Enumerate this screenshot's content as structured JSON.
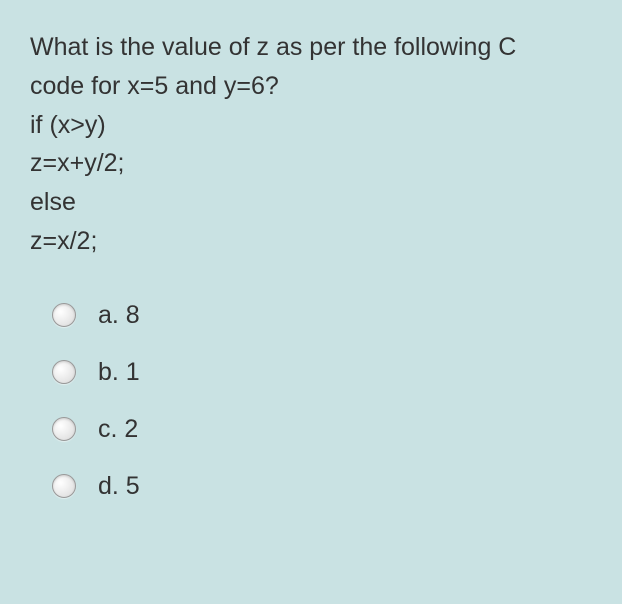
{
  "question": {
    "line1": "What is the value of z as per the following C",
    "line2": "code for x=5 and y=6?",
    "line3": "if (x>y)",
    "line4": " z=x+y/2;",
    "line5": "else",
    "line6": "z=x/2;"
  },
  "options": [
    {
      "label": "a. 8"
    },
    {
      "label": "b. 1"
    },
    {
      "label": "c. 2"
    },
    {
      "label": "d. 5"
    }
  ]
}
